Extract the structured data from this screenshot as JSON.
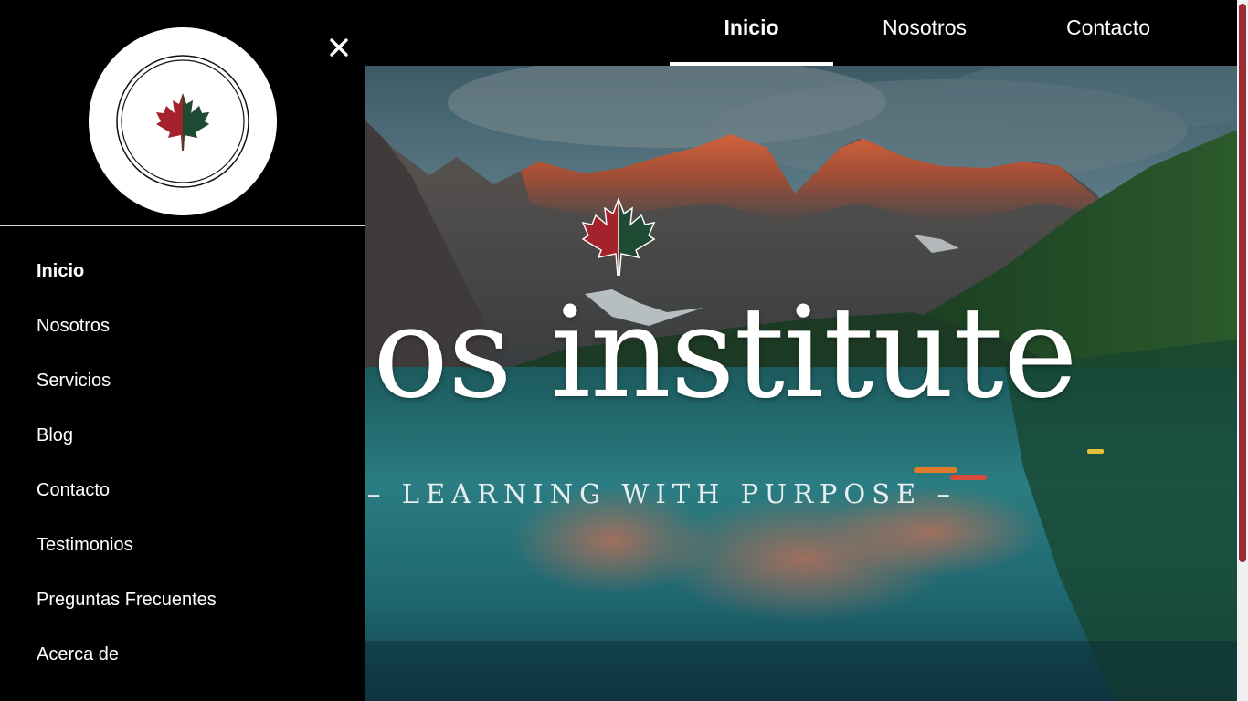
{
  "colors": {
    "background": "#000000",
    "text": "#ffffff",
    "accent_red": "#a3222b",
    "accent_green": "#1f4a33",
    "scrollbar_thumb": "#9b2c33"
  },
  "side_menu": {
    "logo_icon": "maple-leaf-icon",
    "close_icon": "close-icon",
    "items": [
      {
        "label": "Inicio",
        "active": true
      },
      {
        "label": "Nosotros",
        "active": false
      },
      {
        "label": "Servicios",
        "active": false
      },
      {
        "label": "Blog",
        "active": false
      },
      {
        "label": "Contacto",
        "active": false
      },
      {
        "label": "Testimonios",
        "active": false
      },
      {
        "label": "Preguntas Frecuentes",
        "active": false
      },
      {
        "label": "Acerca de",
        "active": false
      }
    ]
  },
  "top_nav": {
    "tabs": [
      {
        "label": "Inicio",
        "active": true
      },
      {
        "label": "Nosotros",
        "active": false
      },
      {
        "label": "Contacto",
        "active": false
      }
    ]
  },
  "hero": {
    "title": "os institute",
    "tagline": "– LEARNING WITH PURPOSE –",
    "background": "mountain-lake-landscape",
    "emblem_icon": "maple-leaf-icon"
  }
}
